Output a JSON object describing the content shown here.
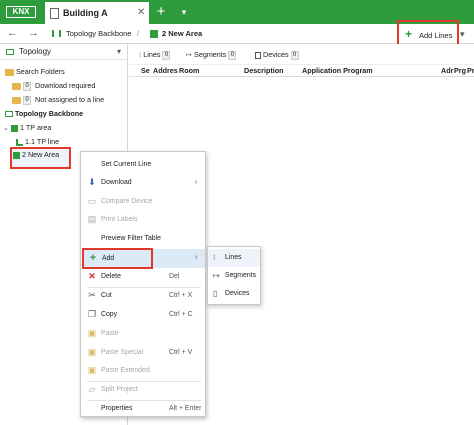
{
  "app": {
    "logo": "KNX",
    "tab_title": "Building A",
    "tab_close": "✕",
    "new_tab": "+",
    "tab_dropdown": "▾"
  },
  "toolbar": {
    "back": "←",
    "forward": "→",
    "breadcrumb_root": "Topology Backbone",
    "breadcrumb_sep": "/",
    "breadcrumb_current": "2 New Area",
    "add_lines": "Add Lines",
    "add_dropdown": "▾"
  },
  "left_panel": {
    "title": "Topology",
    "search_folders": "Search Folders",
    "folders": [
      {
        "count": "0",
        "label": "Download required"
      },
      {
        "count": "0",
        "label": "Not assigned to a line"
      }
    ],
    "backbone": "Topology Backbone",
    "area1": "1 TP area",
    "line1": "1.1 TP line",
    "area2": "2 New Area"
  },
  "right_panel": {
    "tabs": [
      {
        "label": "Lines",
        "count": "0"
      },
      {
        "label": "Segments",
        "count": "0"
      },
      {
        "label": "Devices",
        "count": "0"
      }
    ],
    "columns": [
      "Se",
      "Addres",
      "Room",
      "Description",
      "Application Program",
      "Adr",
      "Prg",
      "Pr"
    ]
  },
  "context_menu": {
    "items": [
      {
        "label": "Set Current Line"
      },
      {
        "label": "Download",
        "arrow": "›"
      },
      {
        "label": "Compare Device"
      },
      {
        "label": "Print Labels"
      },
      {
        "label": "Preview Filter Table"
      },
      {
        "label": "Add",
        "arrow": "›"
      },
      {
        "label": "Delete",
        "shortcut": "Del"
      },
      {
        "label": "Cut",
        "shortcut": "Ctrl + X"
      },
      {
        "label": "Copy",
        "shortcut": "Ctrl + C"
      },
      {
        "label": "Paste"
      },
      {
        "label": "Paste Special",
        "shortcut": "Ctrl + V"
      },
      {
        "label": "Paste Extended"
      },
      {
        "label": "Split Project"
      },
      {
        "label": "Properties",
        "shortcut": "Alt + Enter"
      }
    ]
  },
  "submenu": {
    "items": [
      {
        "label": "Lines"
      },
      {
        "label": "Segments"
      },
      {
        "label": "Devices"
      }
    ]
  },
  "colors": {
    "brand_green": "#2e9c3d",
    "highlight_red": "#e0392b",
    "selected_blue": "#dce9f7"
  }
}
